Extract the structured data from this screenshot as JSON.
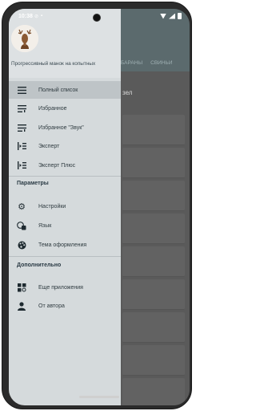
{
  "status_bar": {
    "time": "10:38"
  },
  "drawer": {
    "title": "Прогрессивный манок на копытных",
    "main_items": [
      {
        "label": "Полный список",
        "icon": "list-icon"
      },
      {
        "label": "Избранное",
        "icon": "favorite-list-icon"
      },
      {
        "label": "Избранное \"Звук\"",
        "icon": "favorite-sound-list-icon"
      },
      {
        "label": "Эксперт",
        "icon": "expert-icon"
      },
      {
        "label": "Эксперт Плюс",
        "icon": "expert-plus-icon"
      }
    ],
    "settings_section": "Параметры",
    "settings_items": [
      {
        "label": "Настройки",
        "icon": "gear-icon"
      },
      {
        "label": "Язык",
        "icon": "language-icon"
      },
      {
        "label": "Тема оформления",
        "icon": "palette-icon"
      }
    ],
    "extra_section": "Дополнительно",
    "extra_items": [
      {
        "label": "Еще приложения",
        "icon": "apps-icon"
      },
      {
        "label": "От автора",
        "icon": "person-icon"
      }
    ]
  },
  "background": {
    "tabs": [
      "БАРАНЫ",
      "СВИНЬИ"
    ],
    "fragment": "зел"
  },
  "colors": {
    "drawer_bg": "#d5dadc",
    "active_item_bg": "#bec4c7",
    "app_bar": "#5b6a6d"
  }
}
